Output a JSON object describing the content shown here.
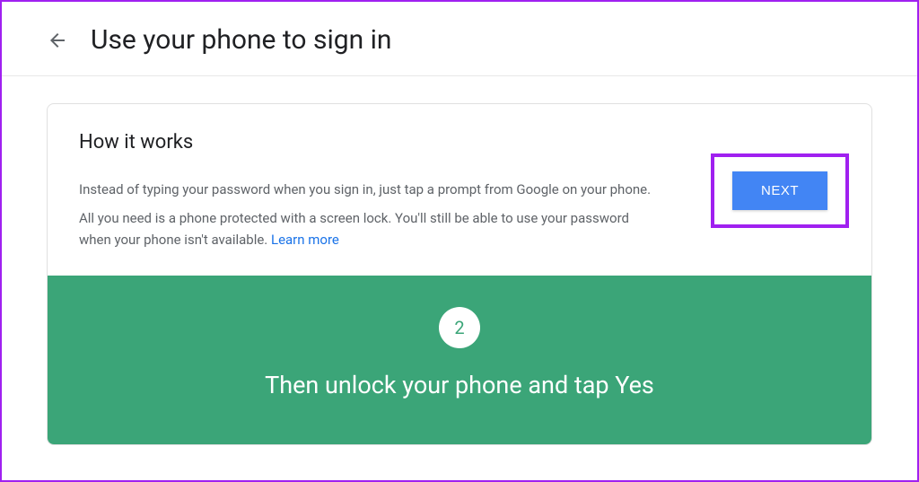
{
  "header": {
    "title": "Use your phone to sign in"
  },
  "card": {
    "title": "How it works",
    "paragraph1": "Instead of typing your password when you sign in, just tap a prompt from Google on your phone.",
    "paragraph2_prefix": "All you need is a phone protected with a screen lock. You'll still be able to use your password when your phone isn't available. ",
    "learn_more": "Learn more",
    "next_button": "NEXT"
  },
  "step": {
    "number": "2",
    "text": "Then unlock your phone and tap Yes"
  }
}
